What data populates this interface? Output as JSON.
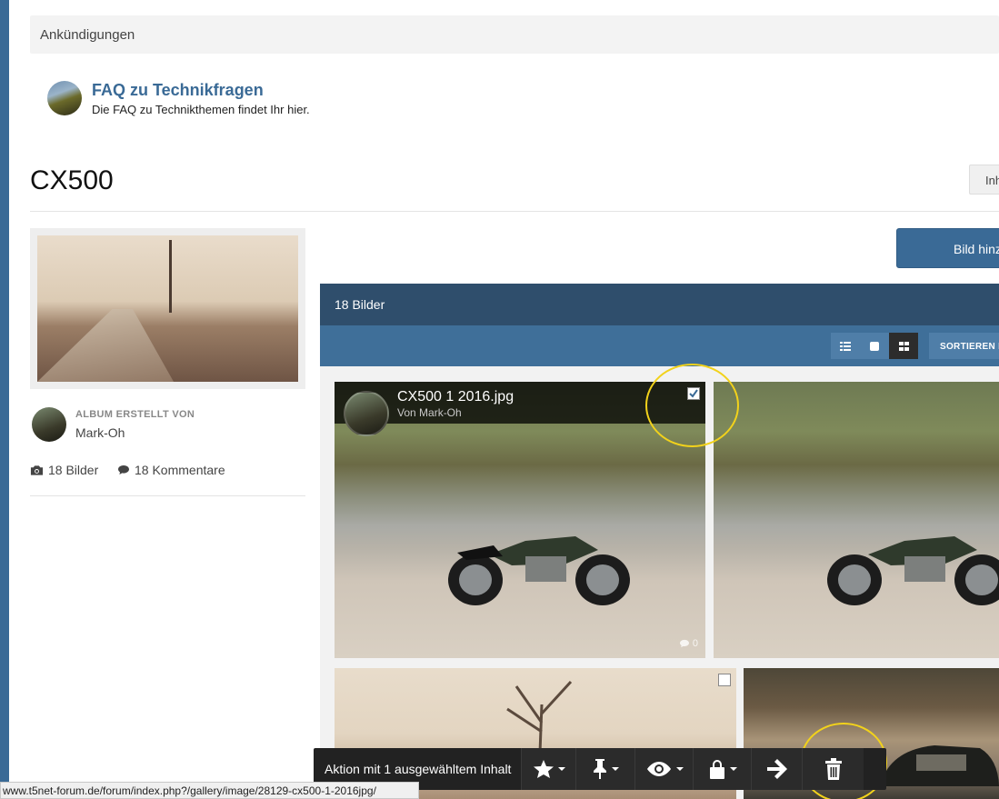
{
  "announcements": {
    "label": "Ankündigungen"
  },
  "faq": {
    "title": "FAQ zu Technikfragen",
    "description": "Die FAQ zu Technikthemen findet Ihr hier."
  },
  "album": {
    "title": "CX500",
    "header_button": "Inh",
    "created_by_label": "ALBUM ERSTELLT VON",
    "author": "Mark-Oh",
    "images_count": "18 Bilder",
    "comments_count": "18 Kommentare"
  },
  "add_image_button": "Bild hinz",
  "gallery": {
    "header": "18 Bilder",
    "sort_label": "SORTIEREN N",
    "views": [
      "list-view",
      "single-view",
      "grid-view"
    ],
    "active_view": "grid-view",
    "tiles": [
      {
        "title": "CX500 1 2016.jpg",
        "author": "Von Mark-Oh",
        "comments": "0",
        "checked": true
      },
      {
        "title": "",
        "author": "",
        "comments": "",
        "checked": false
      },
      {
        "title": "",
        "author": "",
        "comments": "",
        "checked": false
      },
      {
        "title": "",
        "author": "",
        "comments": "",
        "checked": false
      }
    ]
  },
  "action_bar": {
    "label": "Aktion mit 1 ausgewähltem Inhalt",
    "actions": [
      "star-icon",
      "pin-icon",
      "eye-icon",
      "lock-icon",
      "arrow-right-icon",
      "trash-icon"
    ]
  },
  "status_bar": {
    "url": "www.t5net-forum.de/forum/index.php?/gallery/image/28129-cx500-1-2016jpg/"
  },
  "colors": {
    "accent": "#3a6a96",
    "header_dark": "#2f4e6c",
    "toolbar": "#3f6f99",
    "highlight": "#f2d21b",
    "action_bar": "#222222"
  }
}
